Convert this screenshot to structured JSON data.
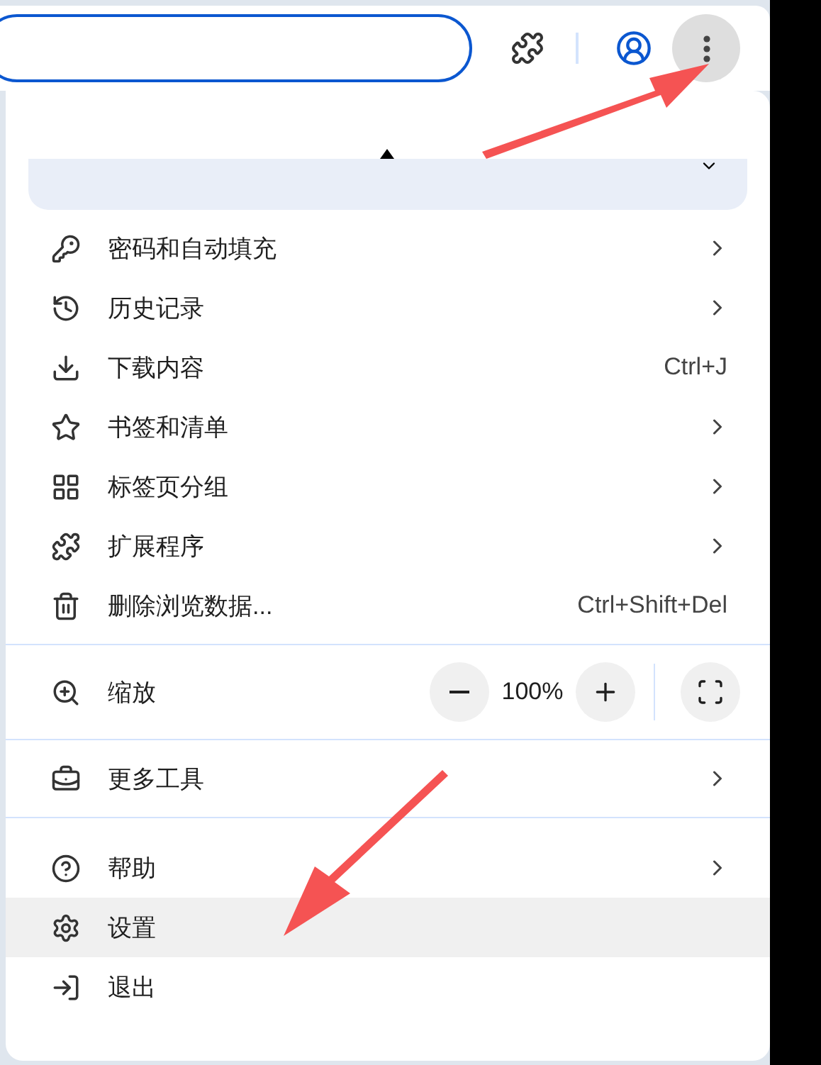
{
  "menu": {
    "groups": [
      {
        "items": [
          {
            "kind": "submenu",
            "label": "密码和自动填充",
            "selected": false
          },
          {
            "kind": "submenu",
            "label": "历史记录",
            "selected": false
          },
          {
            "kind": "shortcut",
            "label": "下载内容",
            "shortcut": "Ctrl+J",
            "selected": false
          },
          {
            "kind": "submenu",
            "label": "书签和清单",
            "selected": false
          },
          {
            "kind": "submenu",
            "label": "标签页分组",
            "selected": false
          },
          {
            "kind": "submenu",
            "label": "扩展程序",
            "selected": false
          },
          {
            "kind": "shortcut",
            "label": "删除浏览数据...",
            "shortcut": "Ctrl+Shift+Del",
            "selected": false
          }
        ]
      },
      {
        "items": [
          {
            "kind": "zoom",
            "label": "缩放",
            "value": "100%",
            "selected": false
          }
        ]
      },
      {
        "items": [
          {
            "kind": "submenu",
            "label": "更多工具",
            "selected": false
          }
        ]
      },
      {
        "items": [
          {
            "kind": "submenu",
            "label": "帮助",
            "selected": false
          },
          {
            "kind": "plain",
            "label": "设置",
            "selected": true
          },
          {
            "kind": "plain",
            "label": "退出",
            "selected": false
          }
        ]
      }
    ]
  }
}
